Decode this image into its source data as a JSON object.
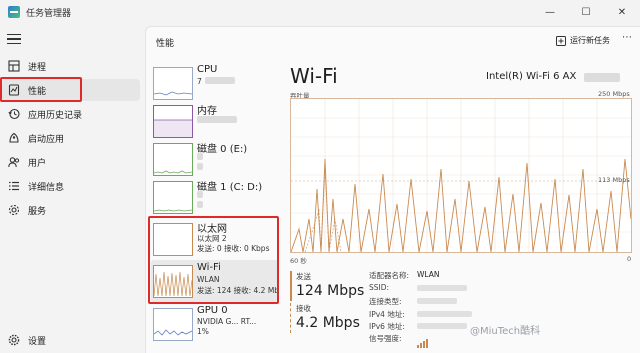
{
  "window": {
    "title": "任务管理器",
    "controls": {
      "minimize": "—",
      "maximize": "☐",
      "close": "✕"
    }
  },
  "sidebar": {
    "items": [
      {
        "label": "进程",
        "icon": "processes-icon"
      },
      {
        "label": "性能",
        "icon": "performance-icon",
        "active": true
      },
      {
        "label": "应用历史记录",
        "icon": "history-icon"
      },
      {
        "label": "启动应用",
        "icon": "startup-icon"
      },
      {
        "label": "用户",
        "icon": "users-icon"
      },
      {
        "label": "详细信息",
        "icon": "details-icon"
      },
      {
        "label": "服务",
        "icon": "services-icon"
      }
    ],
    "settings_label": "设置"
  },
  "header": {
    "title": "性能",
    "run_task": "运行新任务",
    "more": "⋯"
  },
  "devices": [
    {
      "name": "CPU",
      "sub1": "7",
      "sub2": ""
    },
    {
      "name": "内存",
      "sub1": "",
      "sub2": ""
    },
    {
      "name": "磁盘 0 (E:)",
      "sub1": "",
      "sub2": ""
    },
    {
      "name": "磁盘 1 (C: D:)",
      "sub1": "",
      "sub2": ""
    },
    {
      "name": "以太网",
      "sub1": "以太网 2",
      "sub2": "发送: 0 接收: 0 Kbps"
    },
    {
      "name": "Wi-Fi",
      "sub1": "WLAN",
      "sub2": "发送: 124 接收: 4.2 Mb"
    },
    {
      "name": "GPU 0",
      "sub1": "NVIDIA G... RT...",
      "sub2": "1%"
    }
  ],
  "detail": {
    "title": "Wi-Fi",
    "adapter": "Intel(R) Wi-Fi 6 AX",
    "throughput_label": "吞吐量",
    "max_label": "250 Mbps",
    "mid_label": "113 Mbps",
    "time_label": "60 秒",
    "zero_label": "0",
    "send_label": "发送",
    "send_value": "124 Mbps",
    "recv_label": "接收",
    "recv_value": "4.2 Mbps",
    "props": [
      {
        "label": "适配器名称:",
        "value": "WLAN"
      },
      {
        "label": "SSID:",
        "value": ""
      },
      {
        "label": "连接类型:",
        "value": ""
      },
      {
        "label": "IPv4 地址:",
        "value": ""
      },
      {
        "label": "IPv6 地址:",
        "value": ""
      },
      {
        "label": "信号强度:",
        "value": ""
      }
    ]
  },
  "watermark": "@MiuTech酷科",
  "colors": {
    "accent_red": "#e02a2a",
    "net_line": "#c98a50"
  }
}
